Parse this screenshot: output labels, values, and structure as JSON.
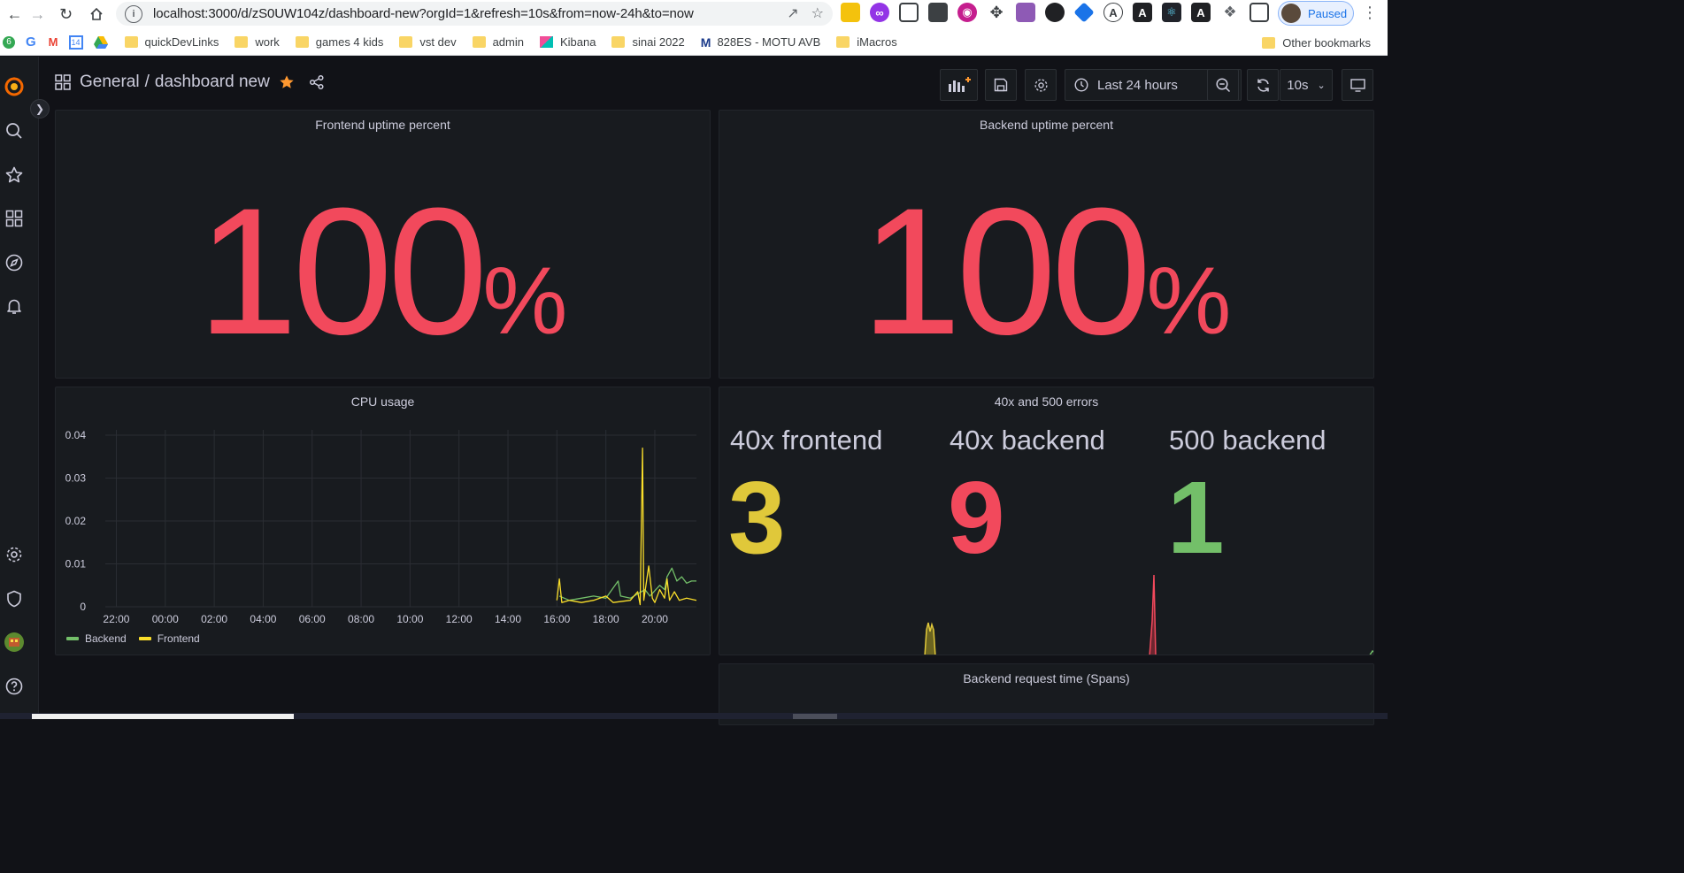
{
  "browser": {
    "url": "localhost:3000/d/zS0UW104z/dashboard-new?orgId=1&refresh=10s&from=now-24h&to=now",
    "profile_label": "Paused",
    "bookmarks": [
      "quickDevLinks",
      "work",
      "games 4 kids",
      "vst dev",
      "admin",
      "Kibana",
      "sinai 2022",
      "828ES - MOTU AVB",
      "iMacros"
    ],
    "other_bookmarks": "Other bookmarks"
  },
  "dashboard": {
    "folder": "General",
    "separator": "/",
    "title": "dashboard new",
    "time_range": "Last 24 hours",
    "refresh_interval": "10s",
    "accent_color": "#f2495c",
    "star_color": "#ff9830"
  },
  "panels": {
    "frontend_uptime": {
      "title": "Frontend uptime percent",
      "value": "100",
      "unit": "%"
    },
    "backend_uptime": {
      "title": "Backend uptime percent",
      "value": "100",
      "unit": "%"
    },
    "errors": {
      "title": "40x and 500 errors",
      "items": [
        {
          "label": "40x frontend",
          "value": "3",
          "color": "#e0c83a"
        },
        {
          "label": "40x backend",
          "value": "9",
          "color": "#f2495c"
        },
        {
          "label": "500 backend",
          "value": "1",
          "color": "#73bf69"
        }
      ]
    },
    "request_time": {
      "title": "Backend request time (Spans)"
    }
  },
  "chart_data": {
    "type": "line",
    "title": "CPU usage",
    "x": [
      "22:00",
      "00:00",
      "02:00",
      "04:00",
      "06:00",
      "08:00",
      "10:00",
      "12:00",
      "14:00",
      "16:00",
      "18:00",
      "20:00"
    ],
    "ylim": [
      0,
      0.04
    ],
    "yticks": [
      "0.04",
      "0.03",
      "0.02",
      "0.01",
      "0"
    ],
    "series": [
      {
        "name": "Backend",
        "color": "#73bf69",
        "points": [
          [
            16.1,
            0.0025
          ],
          [
            16.5,
            0.0015
          ],
          [
            17.0,
            0.002
          ],
          [
            17.5,
            0.0025
          ],
          [
            18.0,
            0.002
          ],
          [
            18.5,
            0.006
          ],
          [
            18.6,
            0.0025
          ],
          [
            19.0,
            0.002
          ],
          [
            19.3,
            0.003
          ],
          [
            19.6,
            0.004
          ],
          [
            19.8,
            0.0025
          ],
          [
            20.2,
            0.005
          ],
          [
            20.4,
            0.004
          ],
          [
            20.5,
            0.007
          ],
          [
            20.7,
            0.009
          ],
          [
            20.9,
            0.006
          ],
          [
            21.1,
            0.007
          ],
          [
            21.3,
            0.0055
          ],
          [
            21.5,
            0.006
          ],
          [
            21.7,
            0.006
          ]
        ]
      },
      {
        "name": "Frontend",
        "color": "#fade2a",
        "points": [
          [
            16.0,
            0.0015
          ],
          [
            16.1,
            0.0065
          ],
          [
            16.2,
            0.001
          ],
          [
            16.5,
            0.0015
          ],
          [
            17.0,
            0.001
          ],
          [
            17.5,
            0.0015
          ],
          [
            18.0,
            0.0025
          ],
          [
            18.3,
            0.001
          ],
          [
            19.0,
            0.0015
          ],
          [
            19.3,
            0.0035
          ],
          [
            19.4,
            0.0005
          ],
          [
            19.5,
            0.037
          ],
          [
            19.55,
            0.0015
          ],
          [
            19.75,
            0.0095
          ],
          [
            19.9,
            0.002
          ],
          [
            20.0,
            0.001
          ],
          [
            20.2,
            0.004
          ],
          [
            20.4,
            0.002
          ],
          [
            20.5,
            0.0065
          ],
          [
            20.6,
            0.0015
          ],
          [
            20.8,
            0.0035
          ],
          [
            21.0,
            0.0015
          ],
          [
            21.3,
            0.002
          ],
          [
            21.7,
            0.0015
          ]
        ]
      }
    ]
  }
}
